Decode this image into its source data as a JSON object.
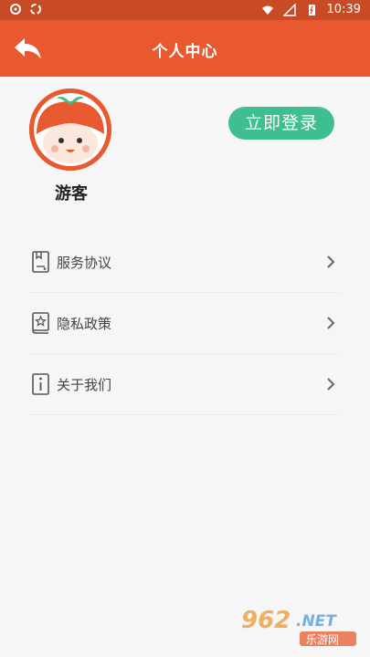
{
  "status_bar": {
    "time": "10:39"
  },
  "header": {
    "title": "个人中心"
  },
  "profile": {
    "username": "游客",
    "login_button": "立即登录"
  },
  "menu": {
    "items": [
      {
        "label": "服务协议",
        "icon": "document-icon"
      },
      {
        "label": "隐私政策",
        "icon": "book-star-icon"
      },
      {
        "label": "关于我们",
        "icon": "info-icon"
      }
    ]
  },
  "watermark": {
    "brand": "962.NET",
    "site": "乐游网"
  },
  "colors": {
    "status_bar": "#c94b25",
    "header": "#e8592f",
    "login_button": "#3fbf8f"
  }
}
